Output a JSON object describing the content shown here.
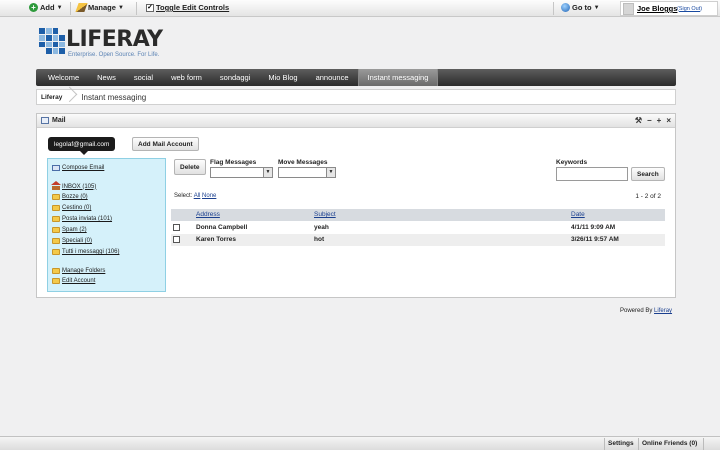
{
  "dockbar": {
    "add_label": "Add",
    "manage_label": "Manage",
    "toggle_label": "Toggle Edit Controls",
    "goto_label": "Go to",
    "user_name": "Joe Bloggs",
    "sign_out": "Sign Out"
  },
  "logo": {
    "name": "LIFERAY",
    "tagline": "Enterprise. Open Source. For Life."
  },
  "nav": {
    "items": [
      "Welcome",
      "News",
      "social",
      "web form",
      "sondaggi",
      "Mio Blog",
      "announce",
      "Instant messaging"
    ],
    "selected": "Instant messaging"
  },
  "breadcrumb": {
    "home": "Liferay",
    "current": "Instant messaging"
  },
  "portlet": {
    "title": "Mail",
    "account": "legolaf@gmail.com",
    "add_account": "Add Mail Account",
    "compose": "Compose Email",
    "folders": [
      {
        "label": "INBOX (105)",
        "icon": "home-icon"
      },
      {
        "label": "Bozze (0)",
        "icon": "folder-icon"
      },
      {
        "label": "Cestino (0)",
        "icon": "folder-icon"
      },
      {
        "label": "Posta inviata (101)",
        "icon": "folder-icon"
      },
      {
        "label": "Spam (2)",
        "icon": "folder-icon"
      },
      {
        "label": "Speciali (0)",
        "icon": "folder-icon"
      },
      {
        "label": "Tutti i messaggi (106)",
        "icon": "folder-icon"
      }
    ],
    "manage_folders": "Manage Folders",
    "edit_account": "Edit Account",
    "delete_label": "Delete",
    "flag_label": "Flag Messages",
    "move_label": "Move Messages",
    "keywords_label": "Keywords",
    "search_label": "Search",
    "select_prefix": "Select:",
    "select_all": "All",
    "select_none": "None",
    "pager": "1 - 2 of 2",
    "columns": {
      "address": "Address",
      "subject": "Subject",
      "date": "Date"
    },
    "messages": [
      {
        "address": "Donna Campbell",
        "subject": "yeah",
        "date": "4/1/11 9:09 AM"
      },
      {
        "address": "Karen Torres",
        "subject": "hot",
        "date": "3/26/11 9:57 AM"
      }
    ]
  },
  "footer": {
    "powered_prefix": "Powered By",
    "powered_link": "Liferay"
  },
  "statusbar": {
    "settings": "Settings",
    "online_friends": "Online Friends (0)"
  }
}
